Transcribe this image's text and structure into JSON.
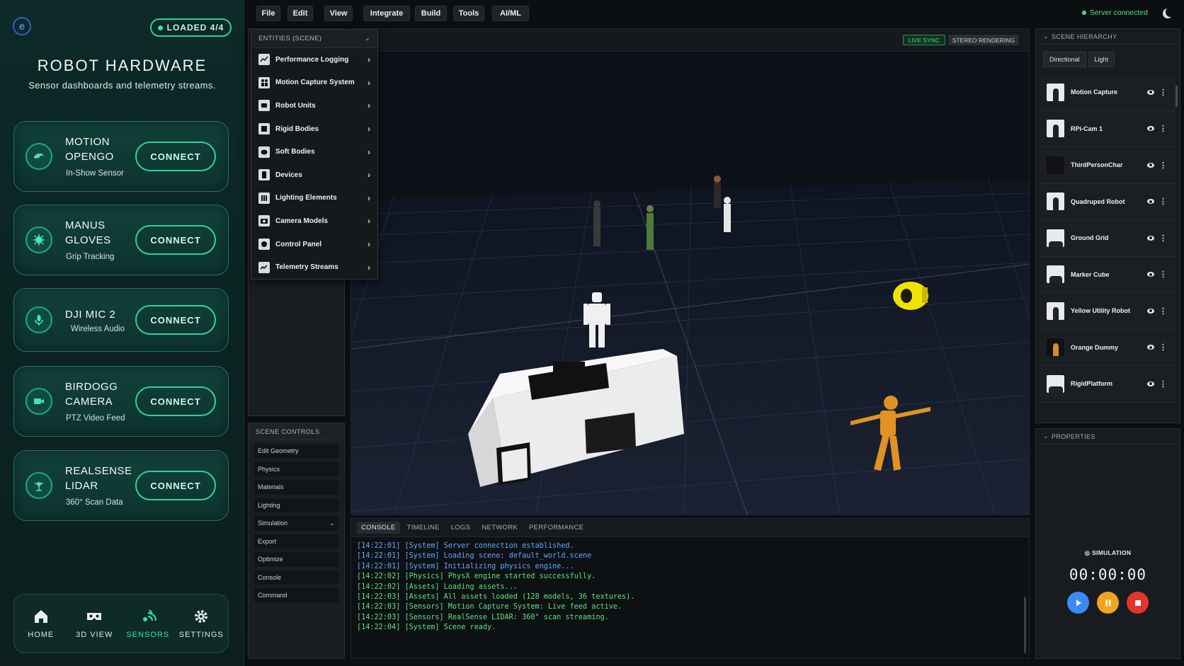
{
  "sidebar": {
    "loaded_badge": "LOADED 4/4",
    "title": "ROBOT HARDWARE",
    "subtitle": "Sensor dashboards and telemetry streams.",
    "devices": [
      {
        "name": "MOTION OPENGO",
        "sub": "In-Show Sensor",
        "button": "CONNECT",
        "icon": "hand-sensor-icon"
      },
      {
        "name": "MANUS GLOVES",
        "sub": "Grip Tracking",
        "button": "CONNECT",
        "icon": "glove-icon"
      },
      {
        "name": "DJI MIC 2",
        "sub": "Wireless Audio",
        "button": "CONNECT",
        "icon": "microphone-icon"
      },
      {
        "name": "BIRDOGG CAMERA",
        "sub": "PTZ Video Feed",
        "button": "CONNECT",
        "icon": "video-camera-icon"
      },
      {
        "name": "REALSENSE LIDAR",
        "sub": "360° Scan Data",
        "button": "CONNECT",
        "icon": "lidar-icon"
      }
    ],
    "nav": [
      {
        "label": "HOME",
        "icon": "home-icon",
        "active": false
      },
      {
        "label": "3D VIEW",
        "icon": "vr-headset-icon",
        "active": false
      },
      {
        "label": "SENSORS",
        "icon": "sensors-icon",
        "active": true
      },
      {
        "label": "SETTINGS",
        "icon": "gear-icon",
        "active": false
      }
    ]
  },
  "menubar": {
    "items": [
      "File",
      "Edit",
      "View",
      "Integrate",
      "Build",
      "Tools",
      "AI/ML"
    ],
    "server_status": "Server connected"
  },
  "entities": {
    "header": "ENTITIES (SCENE)",
    "items": [
      "Performance Logging",
      "Motion Capture System",
      "Robot Units",
      "Rigid Bodies",
      "Soft Bodies",
      "Devices",
      "Lighting Elements",
      "Camera Models",
      "Control Panel",
      "Telemetry Streams"
    ]
  },
  "scene_controls": {
    "title": "SCENE CONTROLS",
    "items": [
      "Edit Geometry",
      "Physics",
      "Materials",
      "Lighting",
      "Simulation",
      "Export",
      "Optimize",
      "Console",
      "Command"
    ]
  },
  "viewport": {
    "live_sync": "LIVE SYNC",
    "stereo": "STEREO RENDERING"
  },
  "console": {
    "tabs": [
      "CONSOLE",
      "TIMELINE",
      "LOGS",
      "NETWORK",
      "PERFORMANCE"
    ],
    "lines": [
      "[14:22:01] [System] Server connection established.",
      "[14:22:01] [System] Loading scene: default_world.scene",
      "[14:22:01] [System] Initializing physics engine...",
      "[14:22:02] [Physics] PhysX engine started successfully.",
      "[14:22:02] [Assets] Loading assets...",
      "[14:22:03] [Assets] All assets loaded (128 models, 36 textures).",
      "[14:22:03] [Sensors] Motion Capture System: Live feed active.",
      "[14:22:03] [Sensors] RealSense LIDAR: 360° scan streaming.",
      "[14:22:04] [System] Scene ready."
    ]
  },
  "hierarchy": {
    "title": "SCENE HIERARCHY",
    "tabs": [
      "Directional",
      "Light"
    ],
    "items": [
      "Motion Capture",
      "RPi-Cam 1",
      "ThirdPersonChar",
      "Quadruped Robot",
      "Ground Grid",
      "Marker Cube",
      "Yellow Utility Robot",
      "Orange Dummy",
      "RigidPlatform"
    ]
  },
  "properties": {
    "title": "PROPERTIES",
    "simulation_label": "SIMULATION",
    "timer": "00:00:00"
  },
  "colors": {
    "accent": "#2fd0a7",
    "sidebar_bg": "#0d2a28",
    "server_ok": "#48e08e",
    "play": "#3c8bf2",
    "pause": "#f2a51c",
    "stop": "#e2352c"
  }
}
